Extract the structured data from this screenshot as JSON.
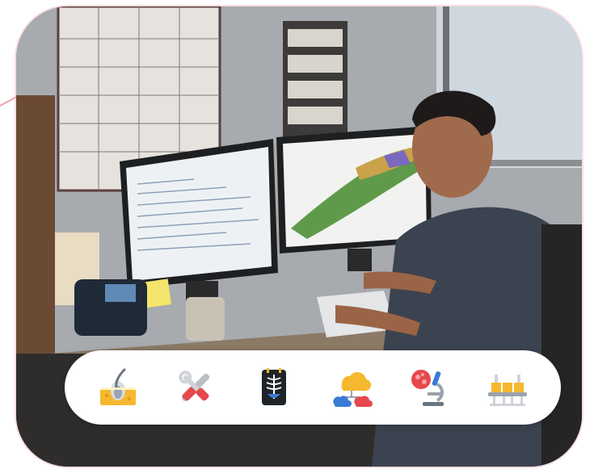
{
  "photo": {
    "subject": "analyst-at-dual-monitor-workstation"
  },
  "icon_bar": {
    "items": [
      {
        "icon": "hair-follicle-icon"
      },
      {
        "icon": "tools-icon"
      },
      {
        "icon": "xray-icon"
      },
      {
        "icon": "cloud-network-icon"
      },
      {
        "icon": "microscope-icon"
      },
      {
        "icon": "conveyor-factory-icon"
      }
    ]
  },
  "colors": {
    "accent": "#f0a0a8",
    "card_bg": "#ffffff",
    "icon_yellow": "#f5b82e",
    "icon_red": "#e5484d",
    "icon_blue": "#3a7bd5"
  }
}
